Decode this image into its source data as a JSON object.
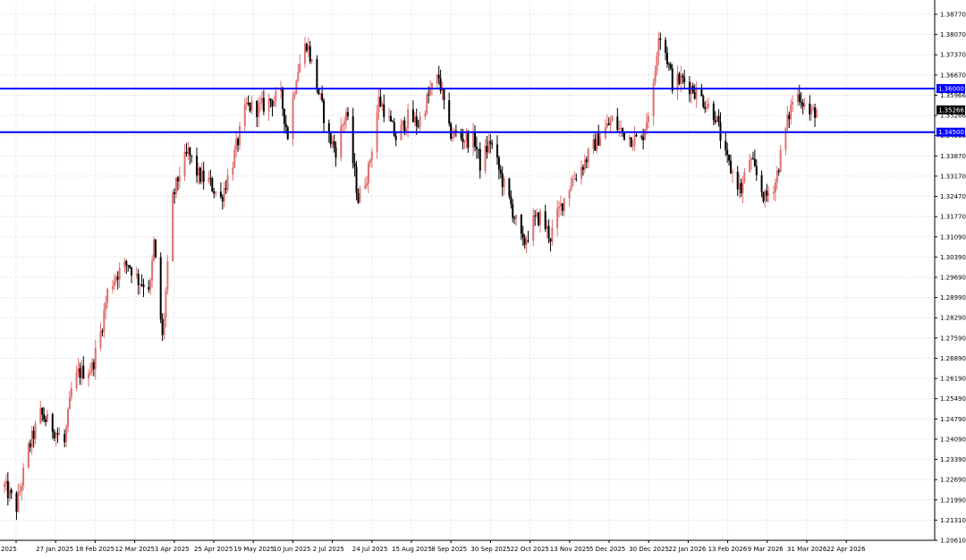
{
  "chart_data": {
    "type": "candlestick",
    "colors": {
      "bull": "#e07070",
      "bear": "#000000",
      "hline": "#0000ff",
      "grid": "#d8d8d8",
      "price_tag_bg": "#000000",
      "price_tag_text": "#ffffff",
      "level_tag_bg": "#0000ff",
      "level_tag_text": "#ffffff"
    },
    "ylim": [
      1.2061,
      1.3877
    ],
    "y_ticks": [
      "1.38770",
      "1.38070",
      "1.37370",
      "1.36670",
      "1.35966",
      "1.35266",
      "1.34566",
      "1.33870",
      "1.33170",
      "1.32470",
      "1.31770",
      "1.31090",
      "1.30390",
      "1.29690",
      "1.28990",
      "1.28290",
      "1.27590",
      "1.26890",
      "1.26190",
      "1.25490",
      "1.24790",
      "1.24090",
      "1.23390",
      "1.22690",
      "1.21990",
      "1.21310",
      "1.20610"
    ],
    "x_tick_labels": [
      "2025",
      "27 Jan 2025",
      "18 Feb 2025",
      "12 Mar 2025",
      "3 Apr 2025",
      "25 Apr 2025",
      "19 May 2025",
      "10 Jun 2025",
      "2 Jul 2025",
      "24 Jul 2025",
      "15 Aug 2025",
      "8 Sep 2025",
      "30 Sep 2025",
      "22 Oct 2025",
      "13 Nov 2025",
      "5 Dec 2025",
      "30 Dec 2025",
      "22 Jan 2026",
      "13 Feb 2026",
      "9 Mar 2026",
      "31 Mar 2026",
      "22 Apr 2026"
    ],
    "horizontal_lines": [
      {
        "value": 1.36,
        "label": "1.36000"
      },
      {
        "value": 1.345,
        "label": "1.34500"
      }
    ],
    "current_price": {
      "value": 1.35266,
      "label": "1.35266"
    },
    "anchors": [
      {
        "date": "2025-01-06",
        "close": 1.223
      },
      {
        "date": "2025-01-13",
        "close": 1.216
      },
      {
        "date": "2025-01-20",
        "close": 1.236
      },
      {
        "date": "2025-01-27",
        "close": 1.248
      },
      {
        "date": "2025-02-05",
        "close": 1.242
      },
      {
        "date": "2025-02-10",
        "close": 1.238
      },
      {
        "date": "2025-02-14",
        "close": 1.256
      },
      {
        "date": "2025-02-18",
        "close": 1.262
      },
      {
        "date": "2025-02-26",
        "close": 1.264
      },
      {
        "date": "2025-03-03",
        "close": 1.276
      },
      {
        "date": "2025-03-07",
        "close": 1.29
      },
      {
        "date": "2025-03-12",
        "close": 1.296
      },
      {
        "date": "2025-03-19",
        "close": 1.3
      },
      {
        "date": "2025-03-25",
        "close": 1.294
      },
      {
        "date": "2025-04-01",
        "close": 1.292
      },
      {
        "date": "2025-04-03",
        "close": 1.307
      },
      {
        "date": "2025-04-08",
        "close": 1.274
      },
      {
        "date": "2025-04-14",
        "close": 1.322
      },
      {
        "date": "2025-04-18",
        "close": 1.331
      },
      {
        "date": "2025-04-23",
        "close": 1.338
      },
      {
        "date": "2025-04-29",
        "close": 1.33
      },
      {
        "date": "2025-05-05",
        "close": 1.328
      },
      {
        "date": "2025-05-12",
        "close": 1.322
      },
      {
        "date": "2025-05-19",
        "close": 1.335
      },
      {
        "date": "2025-05-27",
        "close": 1.354
      },
      {
        "date": "2025-06-03",
        "close": 1.353
      },
      {
        "date": "2025-06-10",
        "close": 1.356
      },
      {
        "date": "2025-06-16",
        "close": 1.357
      },
      {
        "date": "2025-06-20",
        "close": 1.344
      },
      {
        "date": "2025-06-25",
        "close": 1.365
      },
      {
        "date": "2025-07-01",
        "close": 1.376
      },
      {
        "date": "2025-07-07",
        "close": 1.361
      },
      {
        "date": "2025-07-14",
        "close": 1.343
      },
      {
        "date": "2025-07-18",
        "close": 1.339
      },
      {
        "date": "2025-07-24",
        "close": 1.352
      },
      {
        "date": "2025-07-31",
        "close": 1.322
      },
      {
        "date": "2025-08-06",
        "close": 1.332
      },
      {
        "date": "2025-08-12",
        "close": 1.356
      },
      {
        "date": "2025-08-15",
        "close": 1.353
      },
      {
        "date": "2025-08-22",
        "close": 1.343
      },
      {
        "date": "2025-08-29",
        "close": 1.35
      },
      {
        "date": "2025-09-04",
        "close": 1.348
      },
      {
        "date": "2025-09-11",
        "close": 1.359
      },
      {
        "date": "2025-09-16",
        "close": 1.364
      },
      {
        "date": "2025-09-22",
        "close": 1.345
      },
      {
        "date": "2025-09-30",
        "close": 1.343
      },
      {
        "date": "2025-10-07",
        "close": 1.342
      },
      {
        "date": "2025-10-10",
        "close": 1.334
      },
      {
        "date": "2025-10-16",
        "close": 1.342
      },
      {
        "date": "2025-10-22",
        "close": 1.33
      },
      {
        "date": "2025-10-29",
        "close": 1.318
      },
      {
        "date": "2025-11-04",
        "close": 1.306
      },
      {
        "date": "2025-11-10",
        "close": 1.314
      },
      {
        "date": "2025-11-14",
        "close": 1.316
      },
      {
        "date": "2025-11-20",
        "close": 1.309
      },
      {
        "date": "2025-11-25",
        "close": 1.318
      },
      {
        "date": "2025-12-02",
        "close": 1.328
      },
      {
        "date": "2025-12-08",
        "close": 1.333
      },
      {
        "date": "2025-12-12",
        "close": 1.337
      },
      {
        "date": "2025-12-19",
        "close": 1.344
      },
      {
        "date": "2025-12-26",
        "close": 1.349
      },
      {
        "date": "2025-12-30",
        "close": 1.346
      },
      {
        "date": "2026-01-06",
        "close": 1.343
      },
      {
        "date": "2026-01-12",
        "close": 1.342
      },
      {
        "date": "2026-01-19",
        "close": 1.36
      },
      {
        "date": "2026-01-22",
        "close": 1.38
      },
      {
        "date": "2026-01-26",
        "close": 1.373
      },
      {
        "date": "2026-01-30",
        "close": 1.362
      },
      {
        "date": "2026-02-05",
        "close": 1.363
      },
      {
        "date": "2026-02-11",
        "close": 1.36
      },
      {
        "date": "2026-02-17",
        "close": 1.356
      },
      {
        "date": "2026-02-24",
        "close": 1.351
      },
      {
        "date": "2026-03-02",
        "close": 1.336
      },
      {
        "date": "2026-03-06",
        "close": 1.331
      },
      {
        "date": "2026-03-11",
        "close": 1.325
      },
      {
        "date": "2026-03-16",
        "close": 1.336
      },
      {
        "date": "2026-03-20",
        "close": 1.33
      },
      {
        "date": "2026-03-25",
        "close": 1.322
      },
      {
        "date": "2026-03-31",
        "close": 1.328
      },
      {
        "date": "2026-04-06",
        "close": 1.346
      },
      {
        "date": "2026-04-10",
        "close": 1.356
      },
      {
        "date": "2026-04-14",
        "close": 1.358
      },
      {
        "date": "2026-04-20",
        "close": 1.351
      },
      {
        "date": "2026-04-24",
        "close": 1.3527
      }
    ]
  }
}
